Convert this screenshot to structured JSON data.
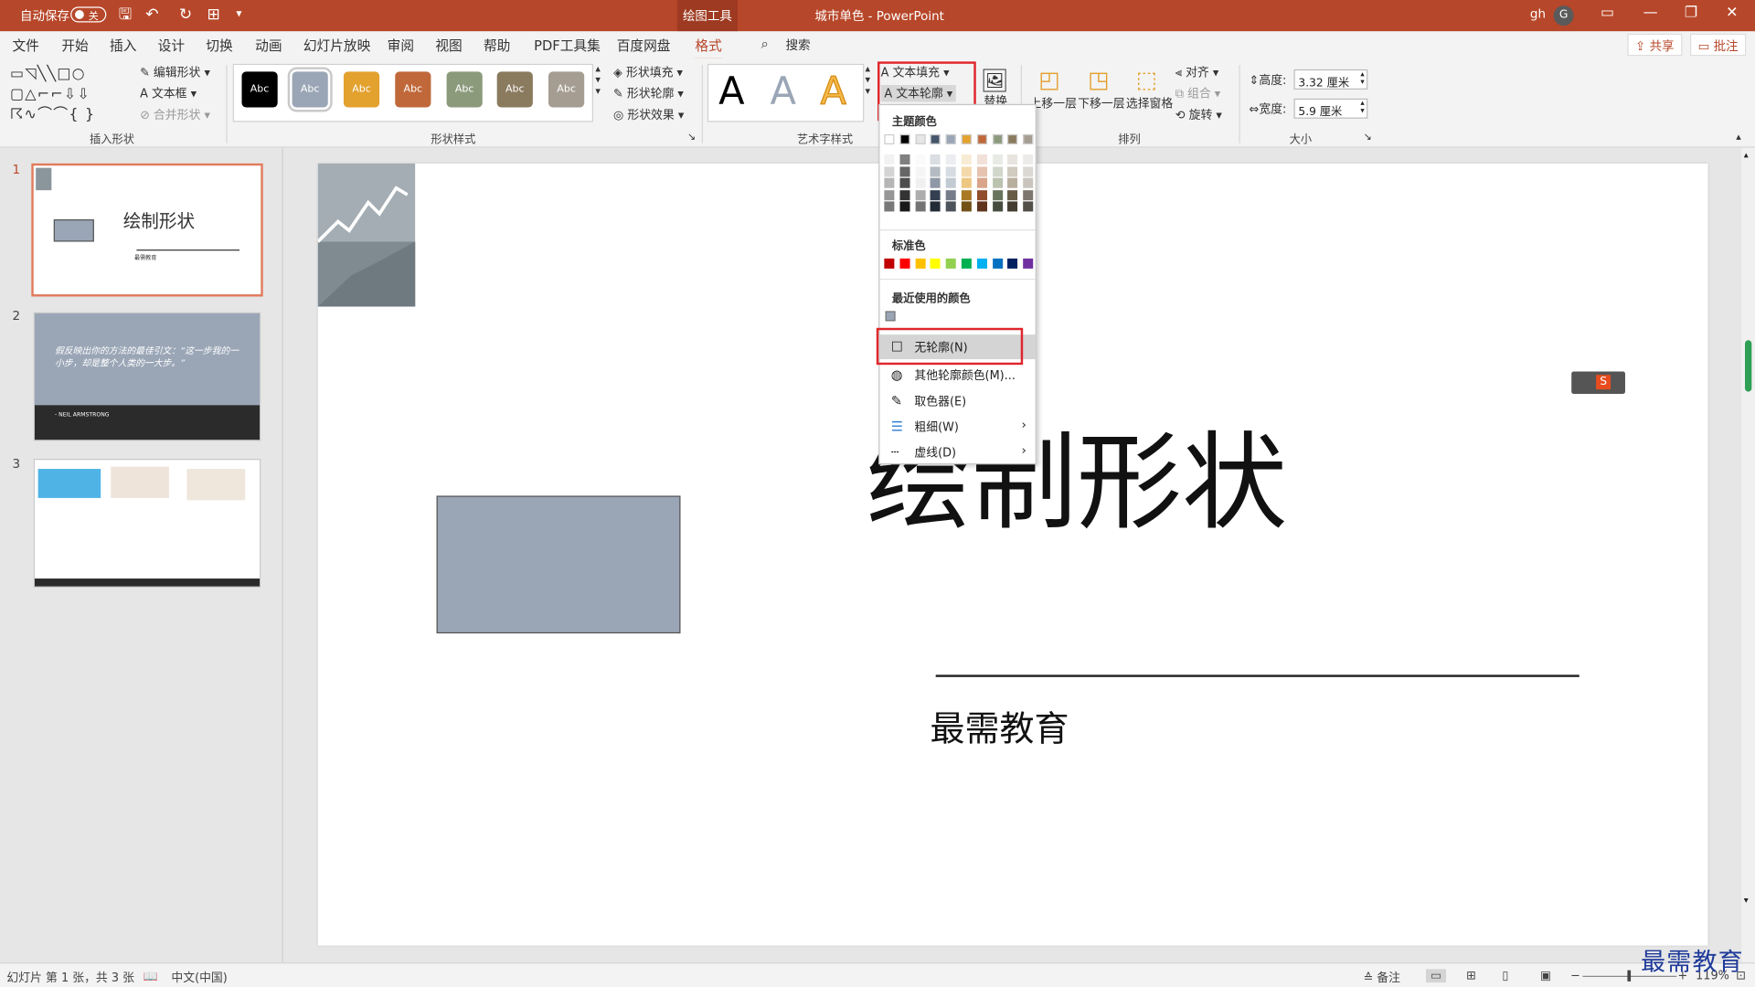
{
  "titlebar": {
    "autosave": "自动保存",
    "toggle": "关",
    "context_tab": "绘图工具",
    "doc_title": "城市单色  -  PowerPoint",
    "user": "gh",
    "avatar": "G"
  },
  "tabs": [
    "文件",
    "开始",
    "插入",
    "设计",
    "切换",
    "动画",
    "幻灯片放映",
    "审阅",
    "视图",
    "帮助",
    "PDF工具集",
    "百度网盘",
    "格式"
  ],
  "search": "搜索",
  "share": "共享",
  "comment": "批注",
  "ribbon": {
    "insert_shapes": {
      "label": "插入形状",
      "edit_shape": "编辑形状",
      "text_box": "文本框",
      "merge_shapes": "合并形状"
    },
    "shape_styles": {
      "label": "形状样式",
      "sample": "Abc",
      "fill": "形状填充",
      "outline": "形状轮廓",
      "effects": "形状效果",
      "colors": [
        "#000000",
        "#9aa6b6",
        "#e3a12e",
        "#c0683a",
        "#8c9a7c",
        "#8a7a5e",
        "#a59d92"
      ]
    },
    "wordart": {
      "label": "艺术字样式",
      "sample": "A",
      "text_fill": "文本填充",
      "text_outline": "文本轮廓",
      "alt_text": "替换"
    },
    "arrange": {
      "label": "排列",
      "bring_forward": "上移一层",
      "send_backward": "下移一层",
      "selection_pane": "选择窗格",
      "align": "对齐",
      "group": "组合",
      "rotate": "旋转"
    },
    "size": {
      "label": "大小",
      "height_label": "高度:",
      "height_value": "3.32 厘米",
      "width_label": "宽度:",
      "width_value": "5.9 厘米"
    }
  },
  "menu": {
    "theme_colors": "主题颜色",
    "theme_top": [
      "#ffffff",
      "#000000",
      "#e7e6e6",
      "#44546a",
      "#9aa6b6",
      "#e3a12e",
      "#c0683a",
      "#8c9a7c",
      "#8a7a5e",
      "#a59d92"
    ],
    "standard": "标准色",
    "standard_colors": [
      "#c00000",
      "#ff0000",
      "#ffc000",
      "#ffff00",
      "#92d050",
      "#00b050",
      "#00b0f0",
      "#0070c0",
      "#002060",
      "#7030a0"
    ],
    "recent": "最近使用的颜色",
    "recent_colors": [
      "#9aa6b6"
    ],
    "items": [
      {
        "label": "无轮廓(N)",
        "icon": "☐"
      },
      {
        "label": "其他轮廓颜色(M)...",
        "icon": "◍"
      },
      {
        "label": "取色器(E)",
        "icon": "✎"
      },
      {
        "label": "粗细(W)",
        "icon": "☰"
      },
      {
        "label": "虚线(D)",
        "icon": "┄"
      }
    ]
  },
  "thumbnails": {
    "numbers": [
      "1",
      "2",
      "3"
    ],
    "slide1_title": "绘制形状",
    "slide1_sub": "最需教育",
    "slide2_quote": "假反映出你的方法的最佳引文：“这一步我的一小步，却是整个人类的一大步。”",
    "slide2_author": "- NEIL ARMSTRONG"
  },
  "slide": {
    "title": "绘制形状",
    "subtitle": "最需教育",
    "shape_color": "#9aa6b6"
  },
  "status": {
    "slide_info": "幻灯片 第 1 张，共 3 张",
    "language": "中文(中国)",
    "notes": "备注",
    "zoom": "119%"
  },
  "watermark": "最需教育"
}
